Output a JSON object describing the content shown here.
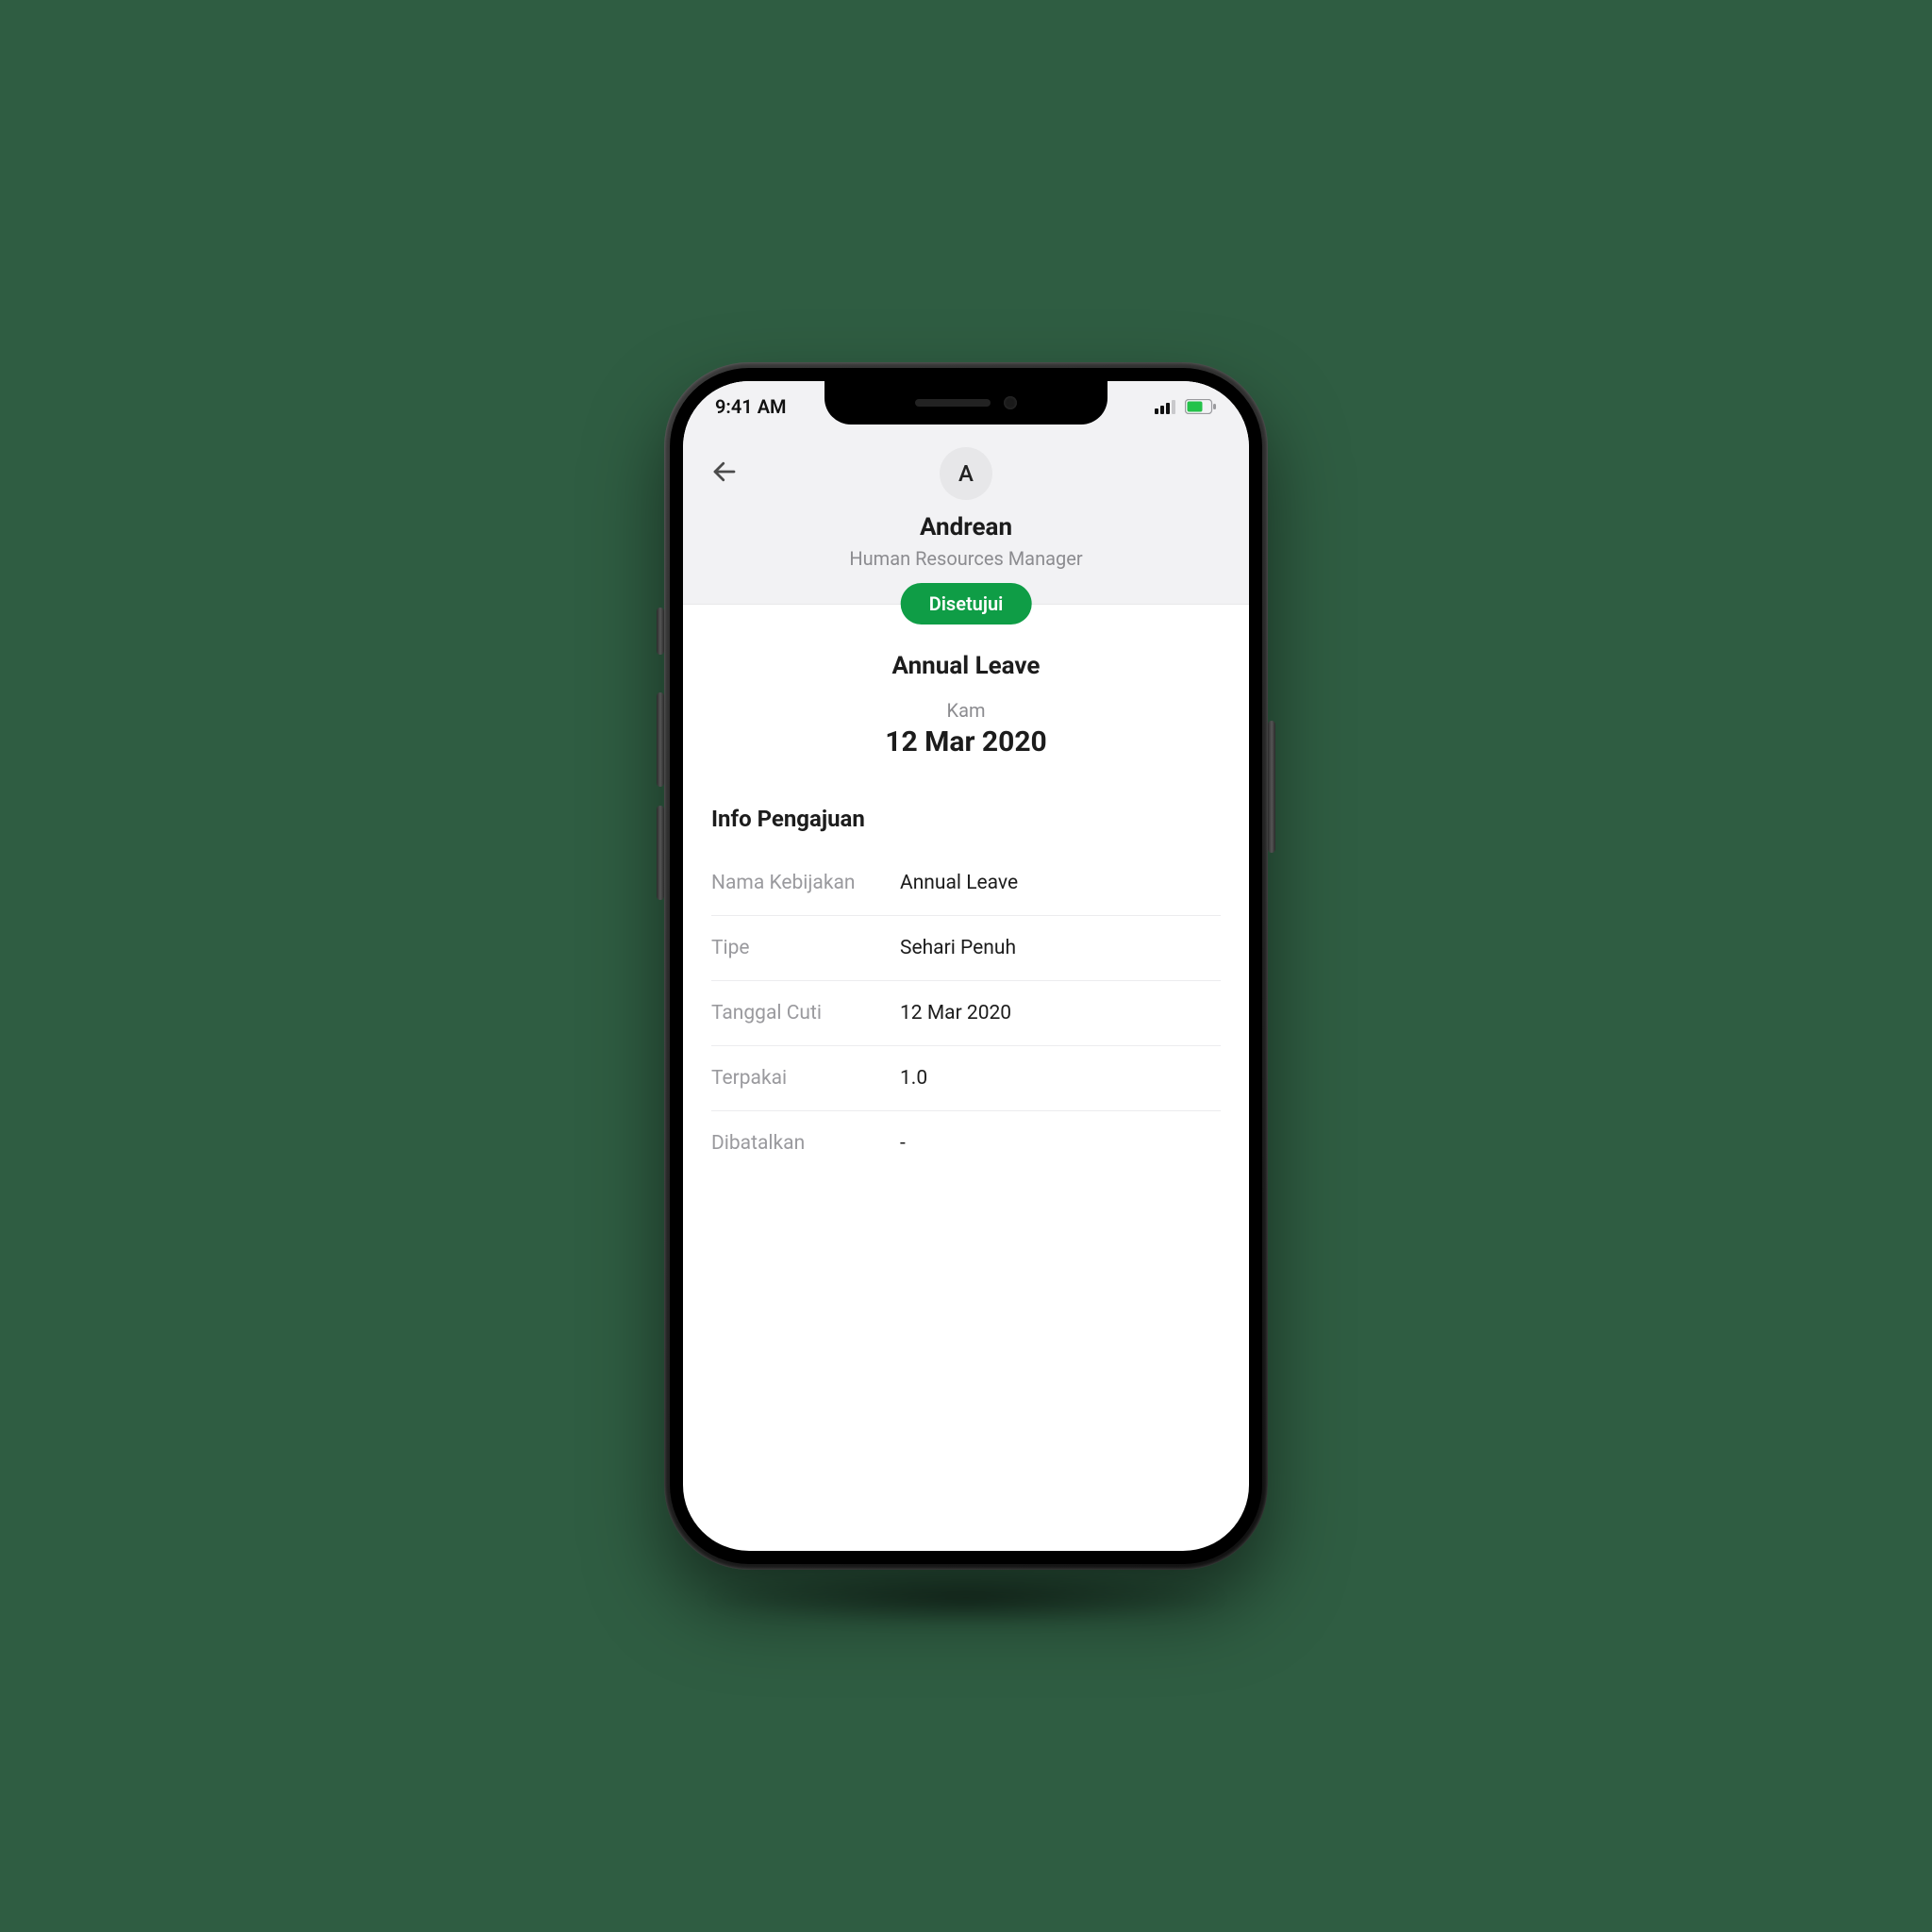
{
  "status_bar": {
    "time": "9:41 AM"
  },
  "header": {
    "avatar_initial": "A",
    "user_name": "Andrean",
    "user_role": "Human Resources Manager"
  },
  "status_pill": "Disetujui",
  "summary": {
    "leave_type_title": "Annual Leave",
    "day_short": "Kam",
    "date": "12 Mar 2020"
  },
  "info": {
    "section_title": "Info Pengajuan",
    "rows": [
      {
        "label": "Nama Kebijakan",
        "value": "Annual Leave"
      },
      {
        "label": "Tipe",
        "value": "Sehari Penuh"
      },
      {
        "label": "Tanggal Cuti",
        "value": "12 Mar 2020"
      },
      {
        "label": "Terpakai",
        "value": "1.0"
      },
      {
        "label": "Dibatalkan",
        "value": "-"
      }
    ]
  },
  "colors": {
    "accent": "#0f9d46",
    "background": "#2f5d42"
  }
}
